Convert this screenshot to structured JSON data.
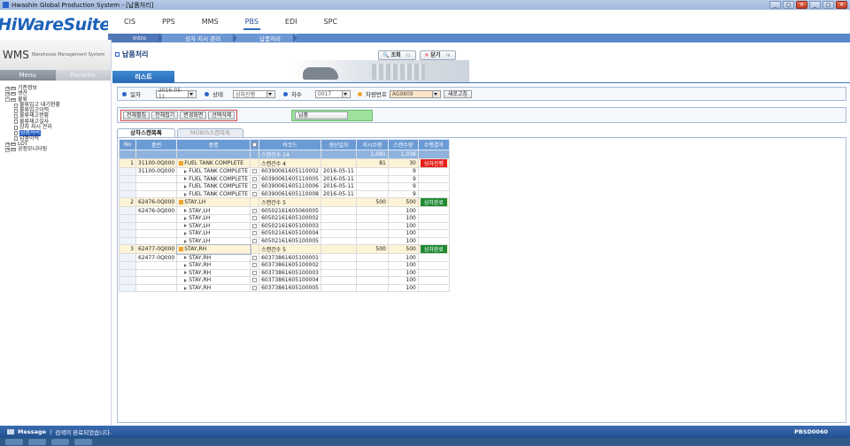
{
  "window": {
    "title": "Hwashin Global Production System - [납품처리]",
    "controls": [
      "_",
      "▢",
      "✕",
      "_",
      "▢",
      "✕"
    ]
  },
  "logo": {
    "text": "HiWareSuite",
    "color": "#1d62b8"
  },
  "top_menu": [
    {
      "label": "CIS",
      "active": false
    },
    {
      "label": "PPS",
      "active": false
    },
    {
      "label": "MMS",
      "active": false
    },
    {
      "label": "PBS",
      "active": true
    },
    {
      "label": "EDI",
      "active": false
    },
    {
      "label": "SPC",
      "active": false
    }
  ],
  "breadcrumb": [
    "Intro",
    "상차 지시 관리",
    "납품처리"
  ],
  "sidebar": {
    "wms_title": "WMS",
    "wms_subtitle": "Warehouse Management System",
    "tabs": [
      "Menu",
      "Favorite"
    ],
    "tree": [
      {
        "label": "기준정보",
        "level": 0,
        "type": "folder",
        "expander": "+"
      },
      {
        "label": "생산",
        "level": 0,
        "type": "folder",
        "expander": "+"
      },
      {
        "label": "물류",
        "level": 0,
        "type": "folder",
        "expander": "-"
      },
      {
        "label": "물류입고 대기현황",
        "level": 1,
        "type": "doc"
      },
      {
        "label": "물류입고이력",
        "level": 1,
        "type": "doc"
      },
      {
        "label": "물류재고현황",
        "level": 1,
        "type": "doc"
      },
      {
        "label": "물류재고실사",
        "level": 1,
        "type": "doc"
      },
      {
        "label": "상차 지시 관리",
        "level": 1,
        "type": "doc"
      },
      {
        "label": "납품처리",
        "level": 1,
        "type": "doc",
        "selected": true
      },
      {
        "label": "납품이력",
        "level": 1,
        "type": "doc"
      },
      {
        "label": "LOT",
        "level": 0,
        "type": "folder",
        "expander": "+"
      },
      {
        "label": "공정모니터링",
        "level": 0,
        "type": "folder",
        "expander": "+"
      }
    ]
  },
  "page": {
    "title": "납품처리",
    "header_buttons": [
      {
        "label": "조회",
        "key": "F1",
        "icon": "search-icon"
      },
      {
        "label": "닫기",
        "key": "F8",
        "icon": "close-icon"
      }
    ],
    "list_tab": "리스트"
  },
  "filters": {
    "date_label": "일자",
    "date_value": "2016-05-11",
    "status_label": "상태",
    "status_value": "상차진행",
    "seq_label": "차수",
    "seq_value": "0017",
    "vehicle_label": "차량번호",
    "vehicle_value": "AG9809",
    "refresh_label": "새로고침"
  },
  "actions": {
    "group": [
      "전체펼침",
      "전체접기",
      "변경화면",
      "선택삭제"
    ],
    "deliver": "납품"
  },
  "grid_tabs": [
    "상차스캔목록",
    "MOBIS스캔목록"
  ],
  "grid": {
    "columns": [
      "No",
      "품번",
      "품명",
      "",
      "바코드",
      "생산일자",
      "지시수량",
      "스캔수량",
      "수행결과"
    ],
    "summary": {
      "barcode": "스캔건수 14",
      "order_qty": "1,081",
      "scan_qty": "1,036"
    },
    "rows": [
      {
        "kind": "group",
        "no": "1",
        "part": "31100-0Q000",
        "name": "FUEL TANK COMPLETE",
        "barcode": "스캔건수 4",
        "date": "",
        "order": "81",
        "scan": "30",
        "result": "상차진행",
        "result_color": "red"
      },
      {
        "kind": "item",
        "part": "31100-0Q000",
        "name": "FUEL TANK COMPLETE",
        "barcode": "60390061605110002",
        "date": "2016-05-11",
        "scan": "9"
      },
      {
        "kind": "item",
        "part": "",
        "name": "FUEL TANK COMPLETE",
        "barcode": "60390061605110005",
        "date": "2016-05-11",
        "scan": "9"
      },
      {
        "kind": "item",
        "part": "",
        "name": "FUEL TANK COMPLETE",
        "barcode": "60390061605110006",
        "date": "2016-05-11",
        "scan": "9"
      },
      {
        "kind": "item",
        "part": "",
        "name": "FUEL TANK COMPLETE",
        "barcode": "60390061605110008",
        "date": "2016-05-11",
        "scan": "9"
      },
      {
        "kind": "group",
        "no": "2",
        "part": "62476-0Q000",
        "name": "STAY,LH",
        "barcode": "스캔건수 5",
        "date": "",
        "order": "500",
        "scan": "500",
        "result": "상차완료",
        "result_color": "green"
      },
      {
        "kind": "item",
        "part": "62476-0Q000",
        "name": "STAY,LH",
        "barcode": "60502161605060005",
        "date": "",
        "scan": "100"
      },
      {
        "kind": "item",
        "part": "",
        "name": "STAY,LH",
        "barcode": "60502161605100002",
        "date": "",
        "scan": "100"
      },
      {
        "kind": "item",
        "part": "",
        "name": "STAY,LH",
        "barcode": "60502161605100003",
        "date": "",
        "scan": "100"
      },
      {
        "kind": "item",
        "part": "",
        "name": "STAY,LH",
        "barcode": "60502161605100004",
        "date": "",
        "scan": "100"
      },
      {
        "kind": "item",
        "part": "",
        "name": "STAY,LH",
        "barcode": "60502161605100005",
        "date": "",
        "scan": "100"
      },
      {
        "kind": "group",
        "no": "3",
        "part": "62477-0Q000",
        "name": "STAY,RH",
        "barcode": "스캔건수 5",
        "date": "",
        "order": "500",
        "scan": "500",
        "result": "상차완료",
        "result_color": "green"
      },
      {
        "kind": "item",
        "part": "62477-0Q000",
        "name": "STAY,RH",
        "barcode": "60373861605100001",
        "date": "",
        "scan": "100"
      },
      {
        "kind": "item",
        "part": "",
        "name": "STAY,RH",
        "barcode": "60373861605100002",
        "date": "",
        "scan": "100"
      },
      {
        "kind": "item",
        "part": "",
        "name": "STAY,RH",
        "barcode": "60373861605100003",
        "date": "",
        "scan": "100"
      },
      {
        "kind": "item",
        "part": "",
        "name": "STAY,RH",
        "barcode": "60373861605100004",
        "date": "",
        "scan": "100"
      },
      {
        "kind": "item",
        "part": "",
        "name": "STAY,RH",
        "barcode": "60373861605100005",
        "date": "",
        "scan": "100"
      }
    ]
  },
  "status": {
    "label": "Message",
    "message": "검색이 완료되었습니다.",
    "code": "PBSD0060"
  },
  "colors": {
    "accent": "#2a62c9",
    "header": "#6b9bd4",
    "red_status": "#e8201a",
    "green_status": "#1f8a33"
  }
}
